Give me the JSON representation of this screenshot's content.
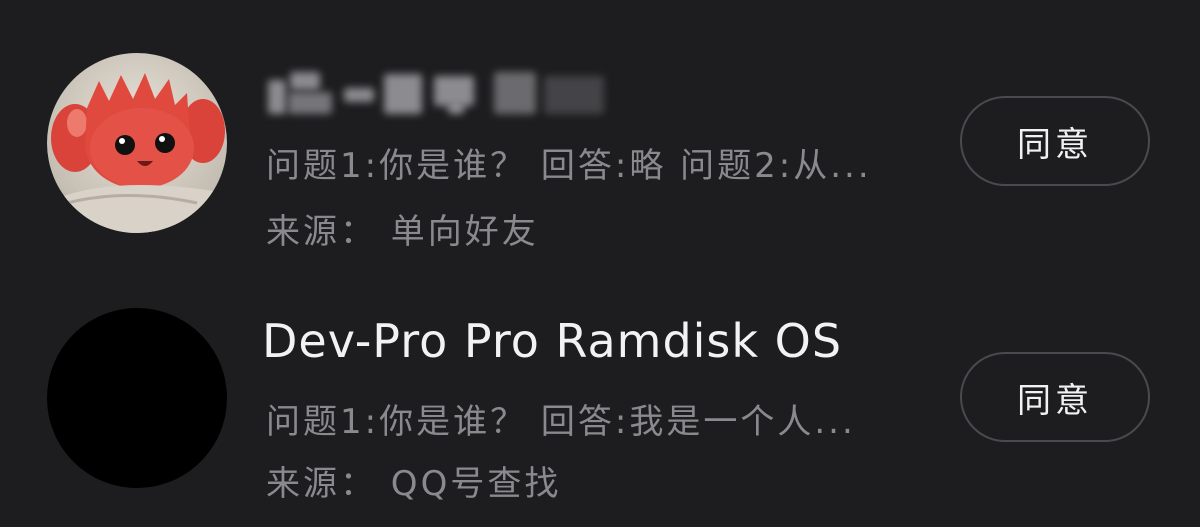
{
  "requests": [
    {
      "name": "",
      "name_blurred": true,
      "question": "问题1:你是谁？  回答:略 问题2:从...",
      "source": "来源：  单向好友",
      "accept_label": "同意",
      "avatar": "crab-mascot-avatar"
    },
    {
      "name": "Dev-Pro Pro Ramdisk OS",
      "question": "问题1:你是谁？  回答:我是一个人...",
      "source": "来源：  QQ号查找",
      "accept_label": "同意",
      "avatar": "black-avatar"
    }
  ]
}
